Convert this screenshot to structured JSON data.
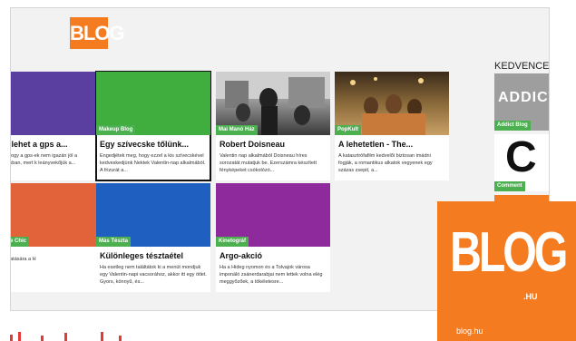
{
  "header": {
    "logo_text": "BLOG"
  },
  "sidebar": {
    "title": "KEDVENCEK"
  },
  "tiles": [
    {
      "tag": "",
      "title": "abb lehet a gps a...",
      "desc": "léma, hogy a gps-ek nem igazán jól a városokban, mert k leányvekőjük a...",
      "color": "#5b3fa0"
    },
    {
      "tag": "Makeup Blog",
      "title": "Egy szívecske tőlünk...",
      "desc": "Engedjétek meg, hogy ezzel a kis szívecskével kedveskedjünk Nektek Valentin-nap alkalmából. A frizurát a...",
      "color": "#3fae3f"
    },
    {
      "tag": "Mai Manó Ház",
      "title": "Robert Doisneau",
      "desc": "Valentin nap alkalmából Doisneau híres sorozatát mutatjuk be. Ezerszámra készített fényképeket csókolózó...",
      "color": "#8a8a8a"
    },
    {
      "tag": "PopKult",
      "title": "A lehetetlen - The...",
      "desc": "A katasztrófafilm kedvelői biztosan imádni fogják, a romantikus alkatok vegyenek egy százas zsepit, a...",
      "color": "#7a5a2c"
    },
    {
      "tag": "n Cycle Chic",
      "title": "",
      "desc": "trend hatására a H",
      "color": "#e2623a"
    },
    {
      "tag": "Más Tészta",
      "title": "Különleges tésztaétel",
      "desc": "Ha esetleg nem találtátok ki a menüt mondjuk egy Valentin-napi vacsorához, akkor itt egy ötlet. Gyors, könnyű, és...",
      "color": "#1f5fbf"
    },
    {
      "tag": "Kinetográf",
      "title": "Argo-akció",
      "desc": "Ha a Hideg nyomon és a Tolvajok városa imponáló zsánerdarabjai nem lettek volna elég meggyőzőek, a tökéletesre...",
      "color": "#8e2a9c"
    }
  ],
  "favorites": [
    {
      "tag": "Addict Blog",
      "label": "ADDICT"
    },
    {
      "tag": "Comment",
      "label": "C"
    },
    {
      "tag": "",
      "label": ""
    }
  ],
  "notification": {
    "logo": "BLOG",
    "suffix": ".HU",
    "site": "blog.hu"
  }
}
